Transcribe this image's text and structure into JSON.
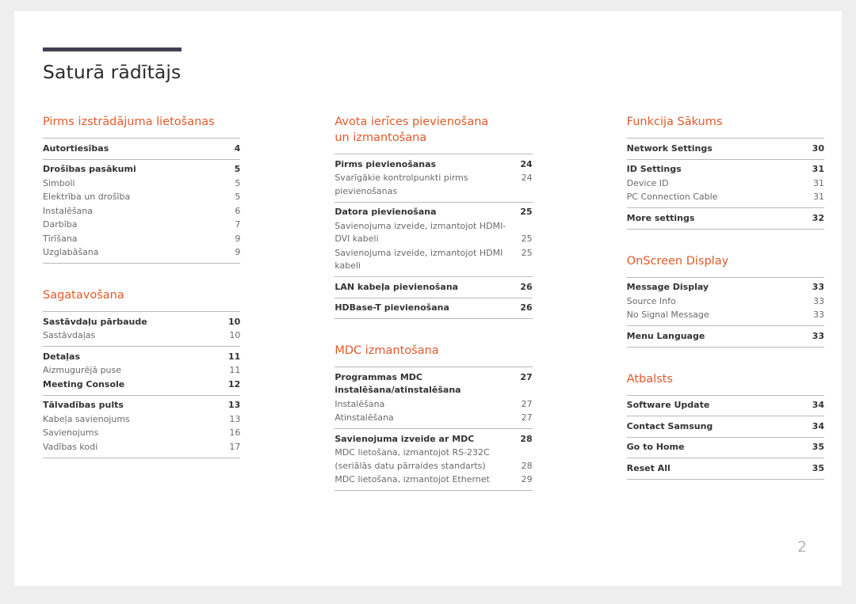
{
  "document": {
    "title": "Saturā rādītājs",
    "page_number": "2",
    "accent_color": "#413f51",
    "heading_color": "#e0592b"
  },
  "columns": [
    {
      "sections": [
        {
          "heading": "Pirms izstrādājuma lietošanas",
          "groups": [
            {
              "entries": [
                {
                  "label": "Autortiesības",
                  "page": "4",
                  "level": "main"
                }
              ]
            },
            {
              "entries": [
                {
                  "label": "Drošības pasākumi",
                  "page": "5",
                  "level": "main"
                },
                {
                  "label": "Simboli",
                  "page": "5",
                  "level": "sub"
                },
                {
                  "label": "Elektrība un drošība",
                  "page": "5",
                  "level": "sub"
                },
                {
                  "label": "Instalēšana",
                  "page": "6",
                  "level": "sub"
                },
                {
                  "label": "Darbība",
                  "page": "7",
                  "level": "sub"
                },
                {
                  "label": "Tīrīšana",
                  "page": "9",
                  "level": "sub"
                },
                {
                  "label": "Uzglabāšana",
                  "page": "9",
                  "level": "sub"
                }
              ]
            }
          ]
        },
        {
          "heading": "Sagatavošana",
          "groups": [
            {
              "entries": [
                {
                  "label": "Sastāvdaļu pārbaude",
                  "page": "10",
                  "level": "main"
                },
                {
                  "label": "Sastāvdaļas",
                  "page": "10",
                  "level": "sub"
                }
              ]
            },
            {
              "entries": [
                {
                  "label": "Detaļas",
                  "page": "11",
                  "level": "main"
                },
                {
                  "label": "Aizmugurējā puse",
                  "page": "11",
                  "level": "sub"
                },
                {
                  "label": "Meeting Console",
                  "page": "12",
                  "level": "main"
                }
              ]
            },
            {
              "entries": [
                {
                  "label": "Tālvadības pults",
                  "page": "13",
                  "level": "main"
                },
                {
                  "label": "Kabeļa savienojums",
                  "page": "13",
                  "level": "sub"
                },
                {
                  "label": "Savienojums",
                  "page": "16",
                  "level": "sub"
                },
                {
                  "label": "Vadības kodi",
                  "page": "17",
                  "level": "sub"
                }
              ]
            }
          ]
        }
      ]
    },
    {
      "sections": [
        {
          "heading": "Avota ierīces pievienošana\nun izmantošana",
          "groups": [
            {
              "entries": [
                {
                  "label": "Pirms pievienošanas",
                  "page": "24",
                  "level": "main"
                },
                {
                  "label": "Svarīgākie kontrolpunkti pirms pievienošanas",
                  "page": "24",
                  "level": "sub"
                }
              ]
            },
            {
              "entries": [
                {
                  "label": "Datora pievienošana",
                  "page": "25",
                  "level": "main"
                },
                {
                  "label": "Savienojuma izveide, izmantojot HDMI-DVI kabeli",
                  "page": "25",
                  "level": "sub",
                  "wrapped": true
                },
                {
                  "label": "Savienojuma izveide, izmantojot HDMI kabeli",
                  "page": "25",
                  "level": "sub"
                }
              ]
            },
            {
              "entries": [
                {
                  "label": "LAN kabeļa pievienošana",
                  "page": "26",
                  "level": "main"
                }
              ]
            },
            {
              "entries": [
                {
                  "label": "HDBase-T pievienošana",
                  "page": "26",
                  "level": "main"
                }
              ]
            }
          ]
        },
        {
          "heading": "MDC izmantošana",
          "groups": [
            {
              "entries": [
                {
                  "label": "Programmas MDC instalēšana/atinstalēšana",
                  "page": "27",
                  "level": "main"
                },
                {
                  "label": "Instalēšana",
                  "page": "27",
                  "level": "sub"
                },
                {
                  "label": "Atinstalēšana",
                  "page": "27",
                  "level": "sub"
                }
              ]
            },
            {
              "entries": [
                {
                  "label": "Savienojuma izveide ar MDC",
                  "page": "28",
                  "level": "main"
                },
                {
                  "label": "MDC lietošana, izmantojot RS-232C (seriālās datu pārraides standarts)",
                  "page": "28",
                  "level": "sub",
                  "wrapped": true
                },
                {
                  "label": "MDC lietošana, izmantojot Ethernet",
                  "page": "29",
                  "level": "sub"
                }
              ]
            }
          ]
        }
      ]
    },
    {
      "sections": [
        {
          "heading": "Funkcija Sākums",
          "groups": [
            {
              "entries": [
                {
                  "label": "Network Settings",
                  "page": "30",
                  "level": "main"
                }
              ]
            },
            {
              "entries": [
                {
                  "label": "ID Settings",
                  "page": "31",
                  "level": "main"
                },
                {
                  "label": "Device ID",
                  "page": "31",
                  "level": "sub"
                },
                {
                  "label": "PC Connection Cable",
                  "page": "31",
                  "level": "sub"
                }
              ]
            },
            {
              "entries": [
                {
                  "label": "More settings",
                  "page": "32",
                  "level": "main"
                }
              ]
            }
          ]
        },
        {
          "heading": "OnScreen Display",
          "groups": [
            {
              "entries": [
                {
                  "label": "Message Display",
                  "page": "33",
                  "level": "main"
                },
                {
                  "label": "Source Info",
                  "page": "33",
                  "level": "sub"
                },
                {
                  "label": "No Signal Message",
                  "page": "33",
                  "level": "sub"
                }
              ]
            },
            {
              "entries": [
                {
                  "label": "Menu Language",
                  "page": "33",
                  "level": "main"
                }
              ]
            }
          ]
        },
        {
          "heading": "Atbalsts",
          "groups": [
            {
              "entries": [
                {
                  "label": "Software Update",
                  "page": "34",
                  "level": "main"
                }
              ]
            },
            {
              "entries": [
                {
                  "label": "Contact Samsung",
                  "page": "34",
                  "level": "main"
                }
              ]
            },
            {
              "entries": [
                {
                  "label": "Go to Home",
                  "page": "35",
                  "level": "main"
                }
              ]
            },
            {
              "entries": [
                {
                  "label": "Reset All",
                  "page": "35",
                  "level": "main"
                }
              ]
            }
          ]
        }
      ]
    }
  ]
}
